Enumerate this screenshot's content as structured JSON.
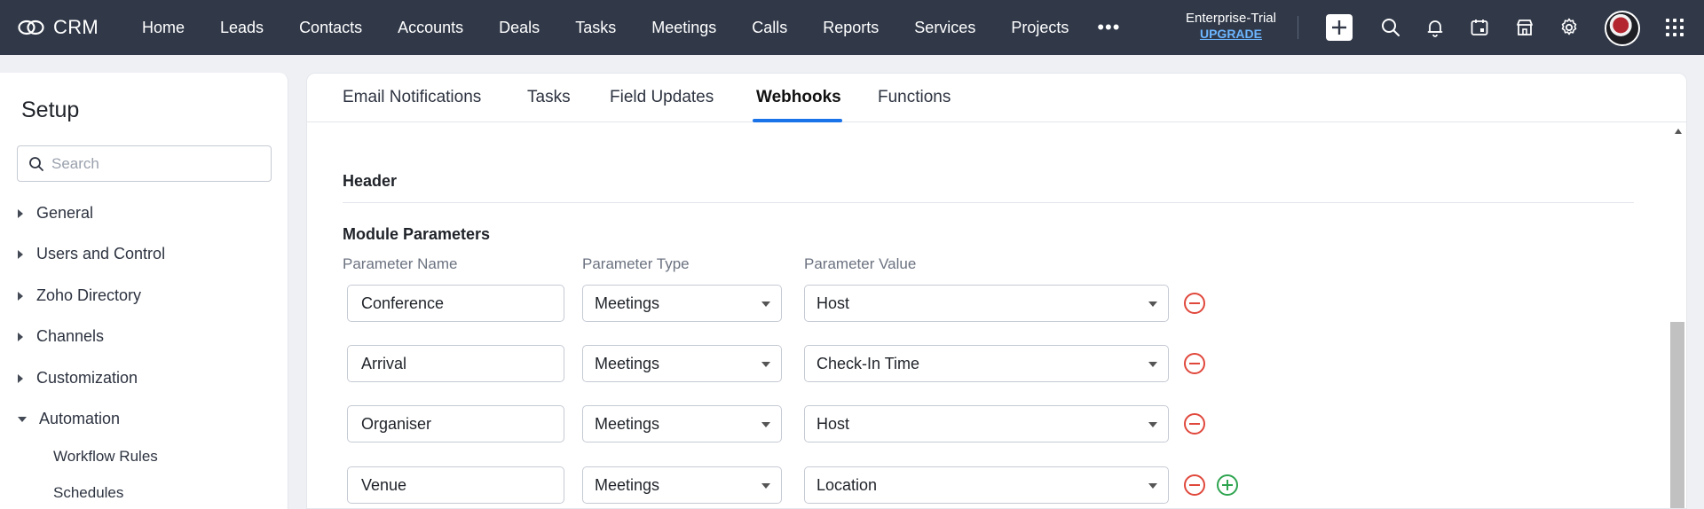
{
  "app": {
    "name": "CRM"
  },
  "nav": {
    "items": [
      "Home",
      "Leads",
      "Contacts",
      "Accounts",
      "Deals",
      "Tasks",
      "Meetings",
      "Calls",
      "Reports",
      "Services",
      "Projects"
    ],
    "more": "•••"
  },
  "trial": {
    "plan": "Enterprise-Trial",
    "upgrade": "UPGRADE"
  },
  "icons": {
    "logo": "crm-logo-icon",
    "create": "plus-icon",
    "search": "search-icon",
    "notifications": "bell-icon",
    "calendar": "calendar-icon",
    "marketplace": "store-icon",
    "settings": "gear-icon",
    "apps": "grid-icon"
  },
  "colors": {
    "topbar": "#313949",
    "accent": "#1a73e8",
    "remove": "#e0473b",
    "add": "#2ea44f"
  },
  "sidebar": {
    "title": "Setup",
    "search_placeholder": "Search",
    "items": [
      {
        "label": "General",
        "expanded": false
      },
      {
        "label": "Users and Control",
        "expanded": false
      },
      {
        "label": "Zoho Directory",
        "expanded": false
      },
      {
        "label": "Channels",
        "expanded": false
      },
      {
        "label": "Customization",
        "expanded": false
      },
      {
        "label": "Automation",
        "expanded": true
      }
    ],
    "subitems": [
      "Workflow Rules",
      "Schedules"
    ]
  },
  "tabs": {
    "items": [
      "Email Notifications",
      "Tasks",
      "Field Updates",
      "Webhooks",
      "Functions"
    ],
    "active": "Webhooks"
  },
  "content": {
    "header_title": "Header",
    "module_title": "Module Parameters",
    "columns": {
      "name": "Parameter Name",
      "type": "Parameter Type",
      "value": "Parameter Value"
    },
    "rows": [
      {
        "name": "Conference",
        "type": "Meetings",
        "value": "Host"
      },
      {
        "name": "Arrival",
        "type": "Meetings",
        "value": "Check-In Time"
      },
      {
        "name": "Organiser",
        "type": "Meetings",
        "value": "Host"
      },
      {
        "name": "Venue",
        "type": "Meetings",
        "value": "Location"
      }
    ]
  }
}
